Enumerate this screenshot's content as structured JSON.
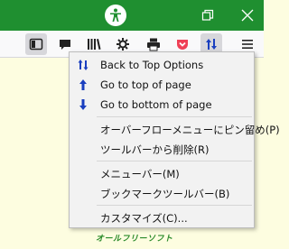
{
  "menu": {
    "items": [
      {
        "label": "Back to Top Options",
        "icon": "back-to-top-options-icon"
      },
      {
        "label": "Go to top of page",
        "icon": "arrow-up-icon"
      },
      {
        "label": "Go to bottom of page",
        "icon": "arrow-down-icon"
      },
      {
        "label": "オーバーフローメニューにピン留め(P)"
      },
      {
        "label": "ツールバーから削除(R)"
      },
      {
        "label": "メニューバー(M)"
      },
      {
        "label": "ブックマークツールバー(B)"
      },
      {
        "label": "カスタマイズ(C)..."
      }
    ]
  },
  "watermark": "オールフリーソフト",
  "colors": {
    "titlebar": "#1f8f30",
    "accent_blue": "#1a3fbf",
    "pocket_red": "#ef4056",
    "content_bg": "#fdfde0",
    "menu_bg": "#f2f2f2"
  }
}
